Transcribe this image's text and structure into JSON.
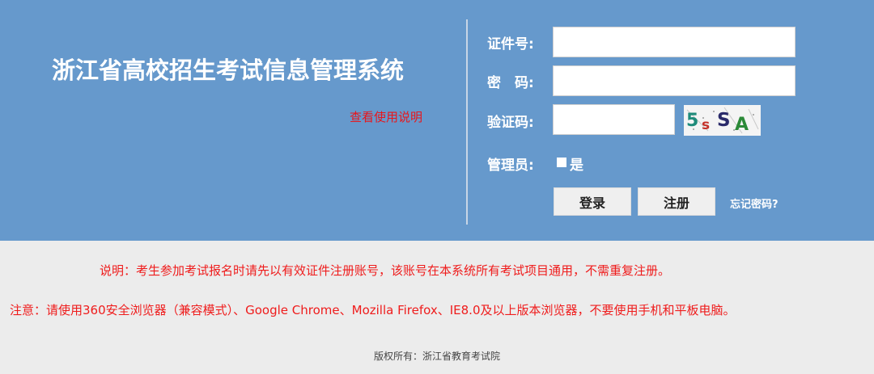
{
  "header": {
    "title": "浙江省高校招生考试信息管理系统",
    "help_link": "查看使用说明"
  },
  "login_form": {
    "id_label": "证件号:",
    "id_value": "",
    "password_label": "密　码:",
    "password_value": "",
    "captcha_label": "验证码:",
    "captcha_value": "",
    "captcha_text": "5sSA",
    "admin_label": "管理员:",
    "admin_option": "是",
    "login_button": "登录",
    "register_button": "注册",
    "forgot_link": "忘记密码?"
  },
  "notes": {
    "description": "说明：考生参加考试报名时请先以有效证件注册账号，该账号在本系统所有考试项目通用，不需重复注册。",
    "browser_notice": "注意：请使用360安全浏览器（兼容模式）、Google Chrome、Mozilla Firefox、IE8.0及以上版本浏览器，不要使用手机和平板电脑。"
  },
  "footer": {
    "copyright": "版权所有：浙江省教育考试院"
  },
  "colors": {
    "banner": "#6699cc",
    "page_background": "#ececec",
    "notice_red": "#ef1c1c"
  }
}
